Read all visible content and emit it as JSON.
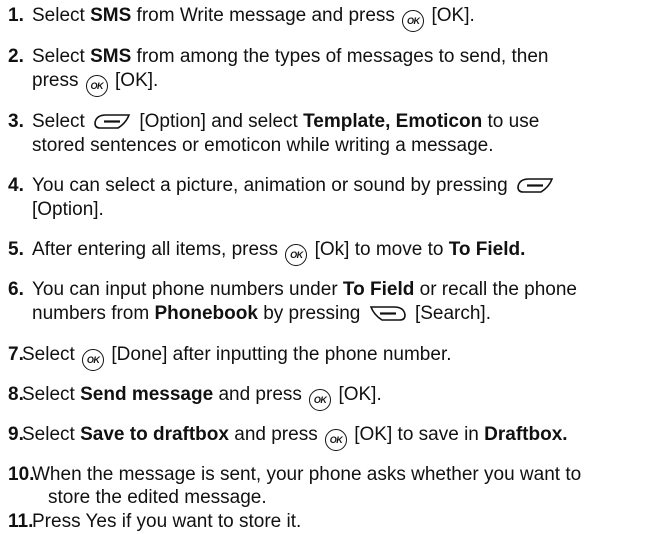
{
  "steps": [
    {
      "n": "1.",
      "parts": [
        "Select ",
        "SMS",
        " from Write message and press ",
        "[OK]."
      ]
    },
    {
      "n": "2.",
      "parts": [
        "Select ",
        "SMS",
        " from among the types of messages to send, then",
        "press ",
        "[OK]."
      ]
    },
    {
      "n": "3.",
      "parts": [
        "Select ",
        "[Option] and select ",
        "Template, Emoticon",
        " to use",
        "stored sentences or emoticon while writing a message."
      ]
    },
    {
      "n": "4.",
      "parts": [
        "You can select a picture, animation or sound by pressing",
        "[Option]."
      ]
    },
    {
      "n": "5.",
      "parts": [
        "After entering all items, press ",
        "[Ok] to move to ",
        "To Field."
      ]
    },
    {
      "n": "6.",
      "parts": [
        "You can input phone numbers under ",
        "To Field",
        " or recall the phone",
        "numbers from ",
        "Phonebook",
        " by pressing ",
        "[Search]."
      ]
    },
    {
      "n": "7.",
      "parts": [
        " Select ",
        "[Done] after inputting the phone number."
      ]
    },
    {
      "n": "8.",
      "parts": [
        " Select ",
        "Send message",
        " and press ",
        "[OK]."
      ]
    },
    {
      "n": "9.",
      "parts": [
        " Select ",
        "Save to draftbox",
        " and press ",
        "[OK] to save in ",
        "Draftbox."
      ]
    },
    {
      "n": "10.",
      "parts": [
        " When the message is sent, your phone asks whether you want to",
        "store the edited message."
      ]
    },
    {
      "n": "11.",
      "parts": [
        " Press Yes if you want to store it."
      ]
    }
  ],
  "icons": {
    "ok_label": "OK"
  }
}
